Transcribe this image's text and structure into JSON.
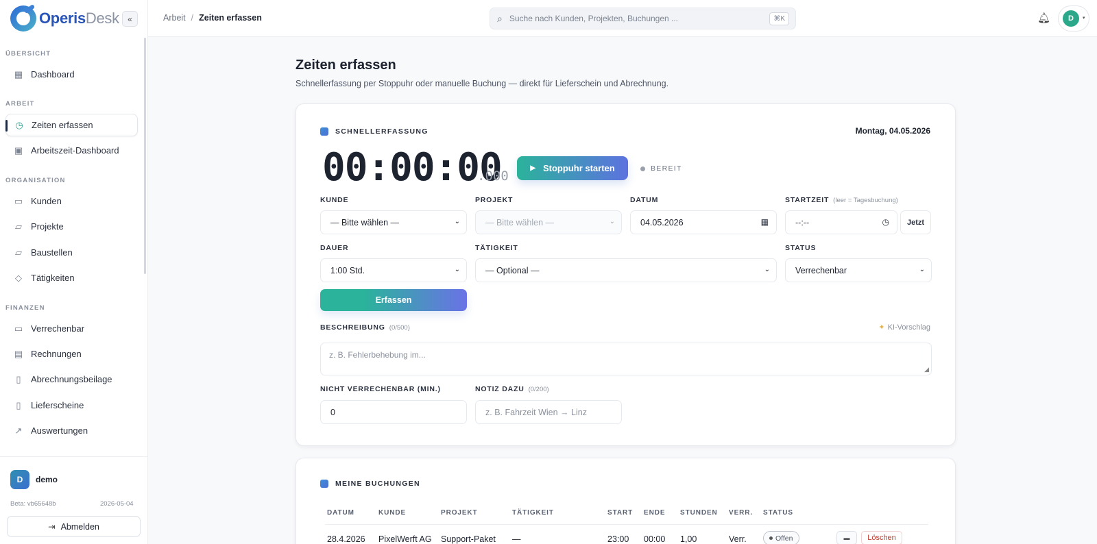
{
  "app": {
    "name_part1": "Operis",
    "name_part2": "Desk",
    "collapse_icon": "«"
  },
  "sidebar": {
    "sections": [
      {
        "label": "ÜBERSICHT"
      },
      {
        "label": "ARBEIT"
      },
      {
        "label": "ORGANISATION"
      },
      {
        "label": "FINANZEN"
      }
    ],
    "items": [
      {
        "label": "Dashboard",
        "icon": "grid-icon"
      },
      {
        "label": "Zeiten erfassen",
        "icon": "clock-icon",
        "active": true
      },
      {
        "label": "Arbeitszeit-Dashboard",
        "icon": "calendar-clock-icon"
      },
      {
        "label": "Kunden",
        "icon": "briefcase-icon"
      },
      {
        "label": "Projekte",
        "icon": "folder-icon"
      },
      {
        "label": "Baustellen",
        "icon": "folder-icon"
      },
      {
        "label": "Tätigkeiten",
        "icon": "tag-icon"
      },
      {
        "label": "Verrechenbar",
        "icon": "money-icon"
      },
      {
        "label": "Rechnungen",
        "icon": "receipt-icon"
      },
      {
        "label": "Abrechnungsbeilage",
        "icon": "document-icon"
      },
      {
        "label": "Lieferscheine",
        "icon": "document-icon"
      },
      {
        "label": "Auswertungen",
        "icon": "trend-icon"
      }
    ],
    "user": {
      "initial": "D",
      "name": "demo"
    },
    "beta": "Beta: vb65648b",
    "beta_date": "2026-05-04",
    "logout_label": "Abmelden"
  },
  "topbar": {
    "breadcrumb_parent": "Arbeit",
    "breadcrumb_sep": "/",
    "breadcrumb_current": "Zeiten erfassen",
    "search_placeholder": "Suche nach Kunden, Projekten, Buchungen ...",
    "search_shortcut": "⌘K",
    "avatar_initial": "D"
  },
  "page": {
    "title": "Zeiten erfassen",
    "subtitle": "Schnellerfassung per Stoppuhr oder manuelle Buchung — direkt für Lieferschein und Abrechnung."
  },
  "quick": {
    "label": "SCHNELLERFASSUNG",
    "date": "Montag, 04.05.2026",
    "timer": "00:00:00",
    "timer_ms": ".000",
    "start_label": "Stoppuhr starten",
    "status": "BEREIT",
    "fields": {
      "kunde_label": "KUNDE",
      "kunde_value": "— Bitte wählen —",
      "projekt_label": "PROJEKT",
      "projekt_value": "— Bitte wählen —",
      "datum_label": "DATUM",
      "datum_value": "04.05.2026",
      "startzeit_label": "STARTZEIT",
      "startzeit_hint": "(leer = Tagesbuchung)",
      "startzeit_value": "--:--",
      "jetzt_label": "Jetzt",
      "dauer_label": "DAUER",
      "dauer_value": "1:00 Std.",
      "taetigkeit_label": "TÄTIGKEIT",
      "taetigkeit_value": "— Optional —",
      "status_label": "STATUS",
      "status_value": "Verrechenbar"
    },
    "submit_label": "Erfassen",
    "beschreibung_label": "BESCHREIBUNG",
    "beschreibung_count": "(0/500)",
    "ki_label": "KI-Vorschlag",
    "beschreibung_placeholder": "z. B. Fehlerbehebung im...",
    "nv_label": "NICHT VERRECHENBAR (MIN.)",
    "nv_value": "0",
    "notiz_label": "NOTIZ DAZU",
    "notiz_count": "(0/200)",
    "notiz_placeholder": "z. B. Fahrzeit Wien → Linz"
  },
  "bookings": {
    "label": "MEINE BUCHUNGEN",
    "columns": [
      "DATUM",
      "KUNDE",
      "PROJEKT",
      "TÄTIGKEIT",
      "START",
      "ENDE",
      "STUNDEN",
      "VERR.",
      "STATUS"
    ],
    "rows": [
      {
        "datum": "28.4.2026",
        "kunde": "PixelWerft AG",
        "projekt": "Support-Paket PixelWerft",
        "taetigkeit": "—",
        "start": "23:00",
        "ende": "00:00",
        "stunden": "1,00",
        "verr": "Verr.",
        "status": "Offen",
        "delete_label": "Löschen"
      }
    ]
  }
}
